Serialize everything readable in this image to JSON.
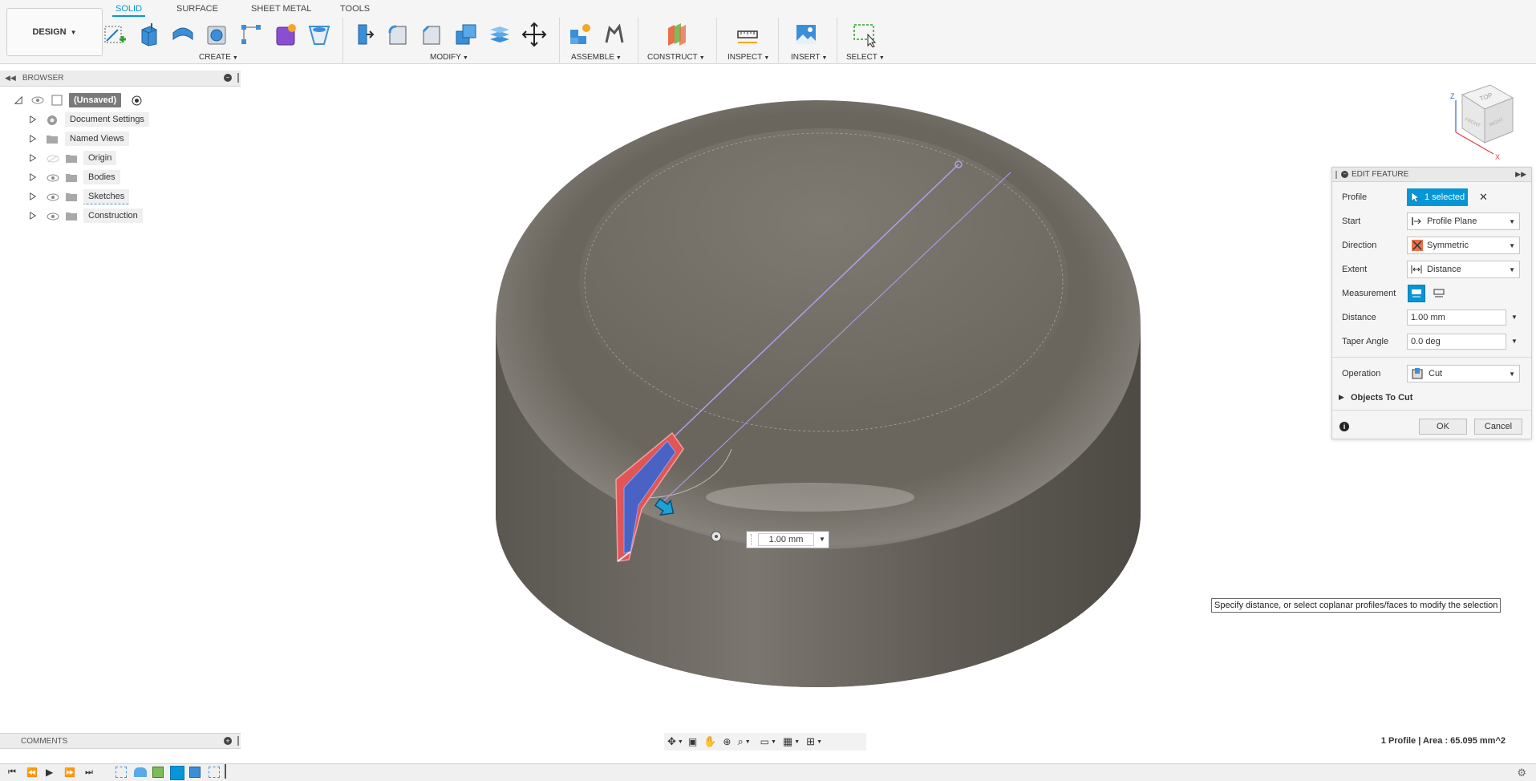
{
  "toolbar": {
    "workspace": "DESIGN",
    "tabs": [
      "SOLID",
      "SURFACE",
      "SHEET METAL",
      "TOOLS"
    ],
    "groups": [
      "CREATE",
      "MODIFY",
      "ASSEMBLE",
      "CONSTRUCT",
      "INSPECT",
      "INSERT",
      "SELECT"
    ]
  },
  "browser": {
    "title": "BROWSER",
    "root": "(Unsaved)",
    "items": [
      "Document Settings",
      "Named Views",
      "Origin",
      "Bodies",
      "Sketches",
      "Construction"
    ]
  },
  "edit_feature": {
    "title": "EDIT FEATURE",
    "profile_label": "Profile",
    "profile_value": "1 selected",
    "start_label": "Start",
    "start_value": "Profile Plane",
    "direction_label": "Direction",
    "direction_value": "Symmetric",
    "extent_label": "Extent",
    "extent_value": "Distance",
    "measurement_label": "Measurement",
    "distance_label": "Distance",
    "distance_value": "1.00 mm",
    "taper_label": "Taper Angle",
    "taper_value": "0.0 deg",
    "operation_label": "Operation",
    "operation_value": "Cut",
    "objects_to_cut": "Objects To Cut",
    "ok": "OK",
    "cancel": "Cancel"
  },
  "viewport": {
    "distance_manipulator": "1.00 mm",
    "tooltip": "Specify distance, or select coplanar profiles/faces to modify the selection",
    "viewcube": {
      "top": "TOP",
      "front": "FRONT",
      "right": "RIGHT",
      "z": "Z",
      "x": "X"
    }
  },
  "comments": {
    "title": "COMMENTS"
  },
  "status": {
    "text": "1 Profile | Area : 65.095 mm^2"
  },
  "colors": {
    "accent": "#0696d7",
    "body": "#6e6a62",
    "cut_red": "#e05555",
    "cut_blue": "#4a62c4"
  }
}
